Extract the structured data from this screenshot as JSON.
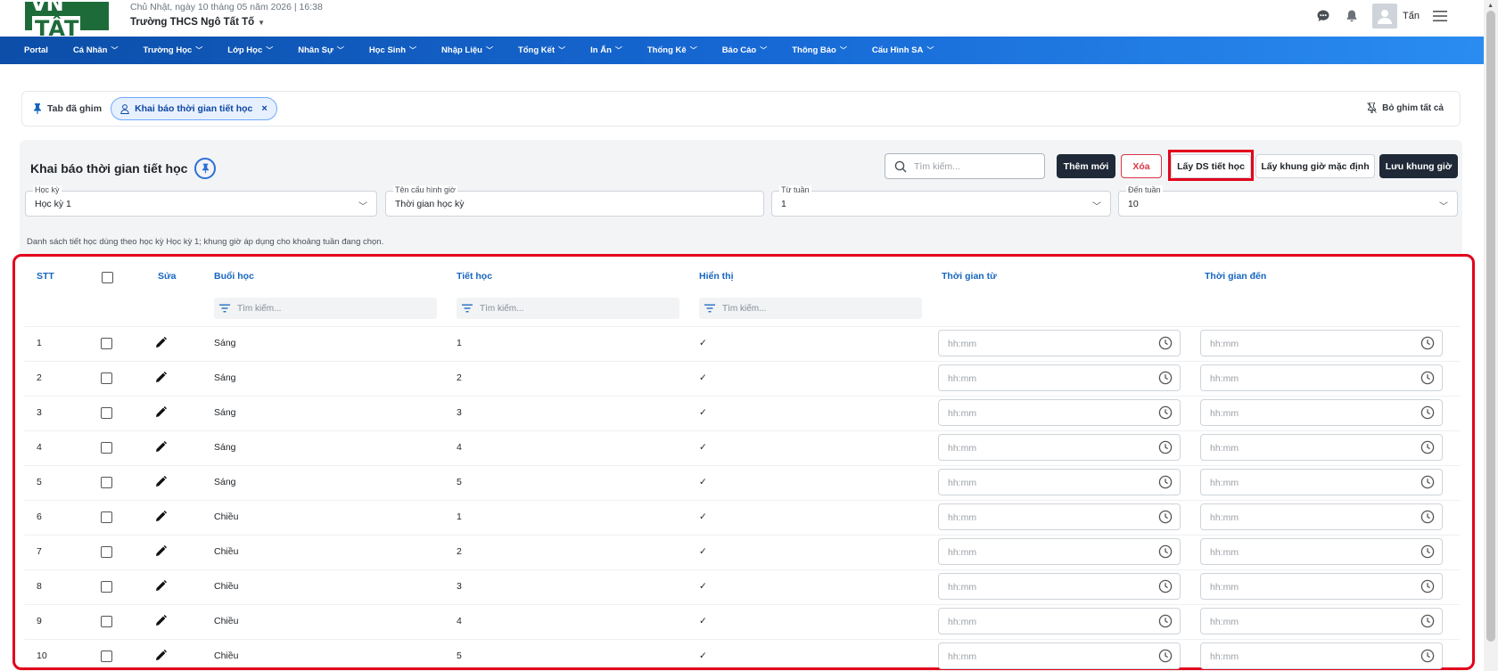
{
  "header": {
    "logo_prefix": "VN",
    "logo_box": "TẤT",
    "date": "Chủ Nhật, ngày 10 tháng 05 năm 2026 | 16:38",
    "school": "Trường THCS Ngô Tất Tố",
    "user": "Tấn"
  },
  "nav": {
    "items": [
      "Portal",
      "Cá Nhân",
      "Trường Học",
      "Lớp Học",
      "Nhân Sự",
      "Học Sinh",
      "Nhập Liệu",
      "Tổng Kết",
      "In Ấn",
      "Thống Kê",
      "Báo Cáo",
      "Thông Báo",
      "Cấu Hình SA"
    ]
  },
  "pinbar": {
    "label": "Tab đã ghim",
    "chip": "Khai báo thời gian tiết học",
    "unpin_all": "Bỏ ghim tất cả"
  },
  "page": {
    "title": "Khai báo thời gian tiết học",
    "search_placeholder": "Tìm kiếm...",
    "btn_add": "Thêm mới",
    "btn_delete": "Xóa",
    "btn_get_periods": "Lấy DS tiết học",
    "btn_default_frame": "Lấy khung giờ mặc định",
    "btn_save": "Lưu khung giờ"
  },
  "filters": {
    "semester_label": "Học kỳ",
    "semester_value": "Học kỳ 1",
    "config_label": "Tên cấu hình giờ",
    "config_value": "Thời gian học kỳ",
    "from_week_label": "Từ tuần",
    "from_week_value": "1",
    "to_week_label": "Đến tuần",
    "to_week_value": "10"
  },
  "hint": "Danh sách tiết học dùng theo học kỳ Học kỳ 1; khung giờ áp dụng cho khoảng tuần đang chọn.",
  "table": {
    "headers": {
      "stt": "STT",
      "edit": "Sửa",
      "session": "Buổi học",
      "period": "Tiết học",
      "visible": "Hiển thị",
      "time_from": "Thời gian từ",
      "time_to": "Thời gian đến"
    },
    "filter_placeholder": "Tìm kiếm...",
    "time_placeholder": "hh:mm",
    "rows": [
      {
        "stt": "1",
        "session": "Sáng",
        "period": "1",
        "visible": "✓"
      },
      {
        "stt": "2",
        "session": "Sáng",
        "period": "2",
        "visible": "✓"
      },
      {
        "stt": "3",
        "session": "Sáng",
        "period": "3",
        "visible": "✓"
      },
      {
        "stt": "4",
        "session": "Sáng",
        "period": "4",
        "visible": "✓"
      },
      {
        "stt": "5",
        "session": "Sáng",
        "period": "5",
        "visible": "✓"
      },
      {
        "stt": "6",
        "session": "Chiều",
        "period": "1",
        "visible": "✓"
      },
      {
        "stt": "7",
        "session": "Chiều",
        "period": "2",
        "visible": "✓"
      },
      {
        "stt": "8",
        "session": "Chiều",
        "period": "3",
        "visible": "✓"
      },
      {
        "stt": "9",
        "session": "Chiều",
        "period": "4",
        "visible": "✓"
      },
      {
        "stt": "10",
        "session": "Chiều",
        "period": "5",
        "visible": "✓"
      }
    ]
  },
  "colors": {
    "nav_start": "#0c4ea8",
    "nav_end": "#2a8cf0",
    "header_text": "#1565c0",
    "highlight": "#e3001b",
    "dark_button": "#1f2937",
    "danger": "#dc3545"
  }
}
